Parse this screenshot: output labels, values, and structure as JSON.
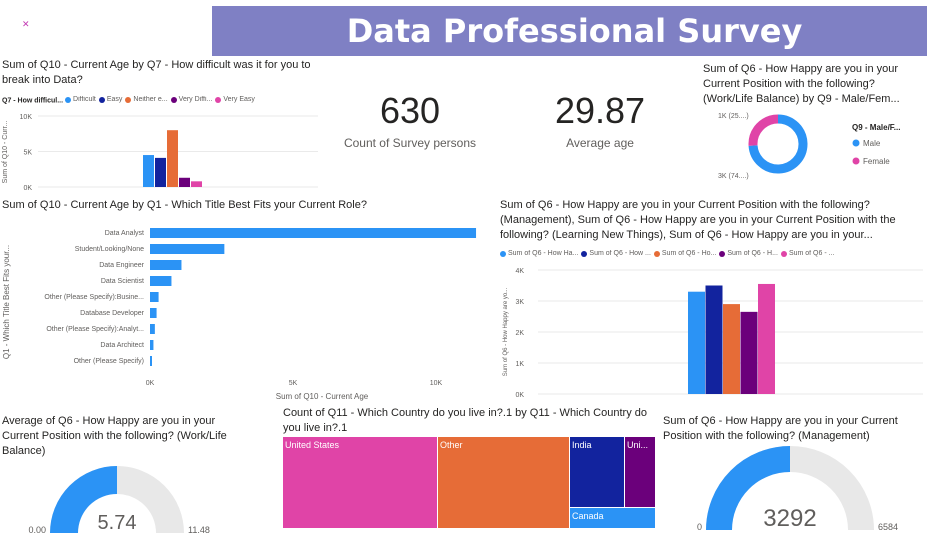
{
  "header": {
    "title": "Data Professional Survey"
  },
  "colors": {
    "banner": "#7f80c4",
    "blue": "#2b93f5",
    "navy": "#12239e",
    "orange": "#e66c37",
    "purple": "#6b007b",
    "pink": "#e044a7",
    "gray": "#e8e8e8"
  },
  "kpis": [
    {
      "value": "630",
      "label": "Count of Survey persons"
    },
    {
      "value": "29.87",
      "label": "Average age"
    }
  ],
  "chart_data": [
    {
      "id": "age_by_difficulty",
      "type": "bar",
      "title": "Sum of Q10 - Current Age by Q7 - How difficult was it for you to break into Data?",
      "legend_title": "Q7 - How difficul...",
      "ylabel": "Sum of Q10 - Curr...",
      "yticks": [
        "0K",
        "5K",
        "10K"
      ],
      "ylim": [
        0,
        10000
      ],
      "series": [
        {
          "name": "Difficult",
          "color": "#2b93f5",
          "value": 4500
        },
        {
          "name": "Easy",
          "color": "#12239e",
          "value": 4100
        },
        {
          "name": "Neither e...",
          "color": "#e66c37",
          "value": 8000
        },
        {
          "name": "Very Diffi...",
          "color": "#6b007b",
          "value": 1300
        },
        {
          "name": "Very Easy",
          "color": "#e044a7",
          "value": 800
        }
      ]
    },
    {
      "id": "worklife_by_gender",
      "type": "pie",
      "title": "Sum of Q6 - How Happy are you in your Current Position with the following? (Work/Life Balance) by Q9 - Male/Fem...",
      "legend_title": "Q9 - Male/F...",
      "labels": [
        "1K (25....)",
        "3K (74....)"
      ],
      "slices": [
        {
          "name": "Male",
          "value": 74,
          "color": "#2b93f5"
        },
        {
          "name": "Female",
          "value": 26,
          "color": "#e044a7"
        }
      ]
    },
    {
      "id": "age_by_role",
      "type": "bar",
      "orientation": "horizontal",
      "title": "Sum of Q10 - Current Age by Q1 - Which Title Best Fits your Current Role?",
      "xlabel": "Sum of Q10 - Current Age",
      "ylabel": "Q1 - Which Title Best Fits your...",
      "xticks": [
        "0K",
        "5K",
        "10K"
      ],
      "xlim": [
        0,
        10000
      ],
      "categories": [
        "Data Analyst",
        "Student/Looking/None",
        "Data Engineer",
        "Data Scientist",
        "Other (Please Specify):Busine...",
        "Database Developer",
        "Other (Please Specify):Analyt...",
        "Data Architect",
        "Other (Please Specify)"
      ],
      "values": [
        11400,
        2600,
        1100,
        750,
        300,
        230,
        170,
        120,
        60
      ]
    },
    {
      "id": "happiness_sums",
      "type": "bar",
      "title": "Sum of Q6 - How Happy are you in your Current Position with the following? (Management), Sum of Q6 - How Happy are you in your Current Position with the following? (Learning New Things), Sum of Q6 - How Happy are you in your...",
      "ylabel": "Sum of Q6 - How Happy are yo...",
      "yticks": [
        "0K",
        "1K",
        "2K",
        "3K",
        "4K"
      ],
      "ylim": [
        0,
        4000
      ],
      "series": [
        {
          "name": "Sum of Q6 - How Ha...",
          "color": "#2b93f5",
          "value": 3300
        },
        {
          "name": "Sum of Q6 - How ...",
          "color": "#12239e",
          "value": 3500
        },
        {
          "name": "Sum of Q6 - Ho...",
          "color": "#e66c37",
          "value": 2900
        },
        {
          "name": "Sum of Q6 - H...",
          "color": "#6b007b",
          "value": 2650
        },
        {
          "name": "Sum of Q6 - ...",
          "color": "#e044a7",
          "value": 3550
        }
      ]
    },
    {
      "id": "gauge_worklife",
      "type": "gauge",
      "title": "Average of Q6 - How Happy are you in your Current Position with the following? (Work/Life Balance)",
      "value": 5.74,
      "value_label": "5.74",
      "min_label": "0.00",
      "max_label": "11.48",
      "min": 0,
      "max": 11.48
    },
    {
      "id": "country_treemap",
      "type": "treemap",
      "title": "Count of Q11 - Which Country do you live in?.1 by Q11 - Which Country do you live in?.1",
      "items": [
        {
          "name": "United States",
          "color": "#e044a7"
        },
        {
          "name": "Other",
          "color": "#e66c37"
        },
        {
          "name": "India",
          "color": "#12239e"
        },
        {
          "name": "Uni...",
          "color": "#6b007b"
        },
        {
          "name": "Canada",
          "color": "#2b93f5"
        }
      ]
    },
    {
      "id": "gauge_management",
      "type": "gauge",
      "title": "Sum of Q6 - How Happy are you in your Current Position with the following? (Management)",
      "value": 3292,
      "value_label": "3292",
      "min_label": "0",
      "max_label": "6584",
      "min": 0,
      "max": 6584
    }
  ]
}
